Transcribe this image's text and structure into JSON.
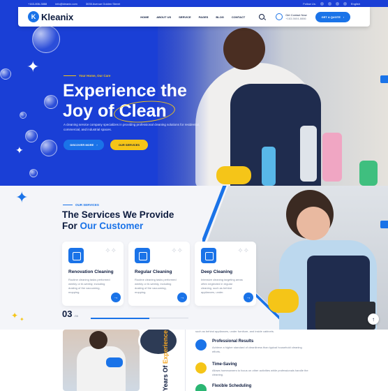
{
  "topbar": {
    "phone": "+163-806-3888",
    "email": "info@kleanix.com",
    "address": "3035 Avenue Golden Street",
    "follow_label": "Follow Us:",
    "social_icons": [
      "facebook-icon",
      "twitter-icon",
      "linkedin-icon",
      "instagram-icon"
    ],
    "language": "English"
  },
  "brand": {
    "name": "Kleanix",
    "mark": "K"
  },
  "nav": {
    "items": [
      "HOME",
      "ABOUT US",
      "SERVICE",
      "PAGES",
      "BLOG",
      "CONTACT"
    ],
    "contact_label": "Get Contact Now",
    "contact_number": "+163-5604-8886",
    "quote_label": "GET A QUOTE"
  },
  "hero": {
    "eyebrow": "Your Home, Our Care",
    "title_line1": "Experience the",
    "title_line2": "Joy of",
    "title_highlight": "Clean",
    "subtitle": "A cleaning service company specializes in providing professional cleaning solutions for residential, commercial, and industrial spaces.",
    "discover_label": "DISCOVER MORE",
    "services_label": "OUR SERVICES"
  },
  "services": {
    "eyebrow": "OUR SERVICES",
    "title_line1": "The Services We Provide",
    "title_for": "For",
    "title_accent": "Our Customer",
    "cards": [
      {
        "title": "Renovation Cleaning",
        "desc": "Routine cleaning tasks performed weekly or bi-weekly, including dusting of the vacuuming, mopping."
      },
      {
        "title": "Regular Cleaning",
        "desc": "Routine cleaning tasks performed weekly or bi-weekly, including dusting of the vacuuming, mopping."
      },
      {
        "title": "Deep Cleaning",
        "desc": "Intensive cleaning targeting areas often neglected in regular cleaning, such as behind appliances, under."
      }
    ],
    "counter": "03",
    "counter_of": "/05",
    "progress": 0.6
  },
  "about": {
    "vertical_prefix": "Years Of",
    "vertical_accent": "Experience",
    "intro_tail": "such as behind appliances, under furniture, and inside cabinets.",
    "features": [
      {
        "title": "Professional Results",
        "desc": "Achieve a higher standard of cleanliness than typical household cleaning efforts.",
        "color": "blue"
      },
      {
        "title": "Time-Saving",
        "desc": "Allows homeowners to focus on other activities while professionals handle the cleaning.",
        "color": "yellow"
      },
      {
        "title": "Flexible Scheduling",
        "desc": "",
        "color": "green"
      }
    ]
  },
  "colors": {
    "primary": "#1a73e8",
    "hero_bg": "#1a3fd6",
    "accent": "#f5c518",
    "dark": "#0d1b3e"
  }
}
